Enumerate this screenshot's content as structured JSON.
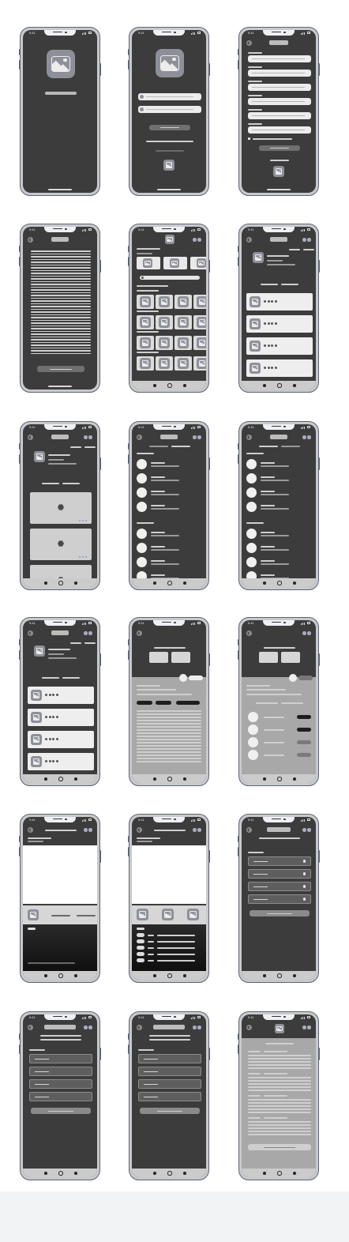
{
  "status_time": "9:41",
  "colors": {
    "phone_frame": "#5d6472",
    "screen_dark": "#3c3c3c",
    "panel_gray": "#a8a8a8",
    "placeholder_icon": "#8e9099",
    "accent_dots": "#a8aabf"
  },
  "icons": {
    "placeholder": "image-placeholder-icon",
    "back": "back-arrow-icon",
    "product": "hexagon-icon"
  },
  "screens": [
    {
      "id": "splash"
    },
    {
      "id": "login"
    },
    {
      "id": "signup-form"
    },
    {
      "id": "terms-text"
    },
    {
      "id": "home-gallery"
    },
    {
      "id": "profile-list"
    },
    {
      "id": "profile-products"
    },
    {
      "id": "follow-list-a"
    },
    {
      "id": "follow-list-b"
    },
    {
      "id": "profile-list-2"
    },
    {
      "id": "detail-tabs-text"
    },
    {
      "id": "detail-tabs-toggles"
    },
    {
      "id": "media-player-a"
    },
    {
      "id": "media-player-b"
    },
    {
      "id": "settings-menu"
    },
    {
      "id": "settings-list-a"
    },
    {
      "id": "settings-list-b"
    },
    {
      "id": "document-view"
    }
  ]
}
